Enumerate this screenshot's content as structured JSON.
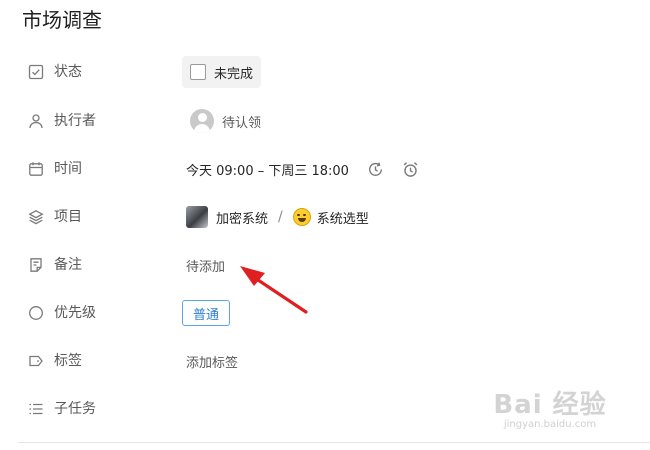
{
  "title": "市场调查",
  "fields": {
    "status": {
      "label": "状态",
      "value": "未完成",
      "icon": "checkbox-icon"
    },
    "assignee": {
      "label": "执行者",
      "value": "待认领",
      "icon": "person-icon"
    },
    "time": {
      "label": "时间",
      "value": "今天 09:00  –  下周三 18:00",
      "icon": "calendar-icon"
    },
    "project": {
      "label": "项目",
      "project": "加密系统",
      "separator": "/",
      "subproject": "系统选型",
      "icon": "layers-icon"
    },
    "note": {
      "label": "备注",
      "value": "待添加",
      "icon": "note-icon"
    },
    "priority": {
      "label": "优先级",
      "value": "普通",
      "icon": "circle-icon"
    },
    "tags": {
      "label": "标签",
      "value": "添加标签",
      "icon": "tag-icon"
    },
    "subtasks": {
      "label": "子任务",
      "icon": "list-icon"
    }
  },
  "watermark": {
    "main": "Bai 经验",
    "sub": "jingyan.baidu.com"
  },
  "colors": {
    "accent": "#2f80d1",
    "arrow": "#e02020",
    "text": "#262626",
    "muted": "#595959"
  }
}
